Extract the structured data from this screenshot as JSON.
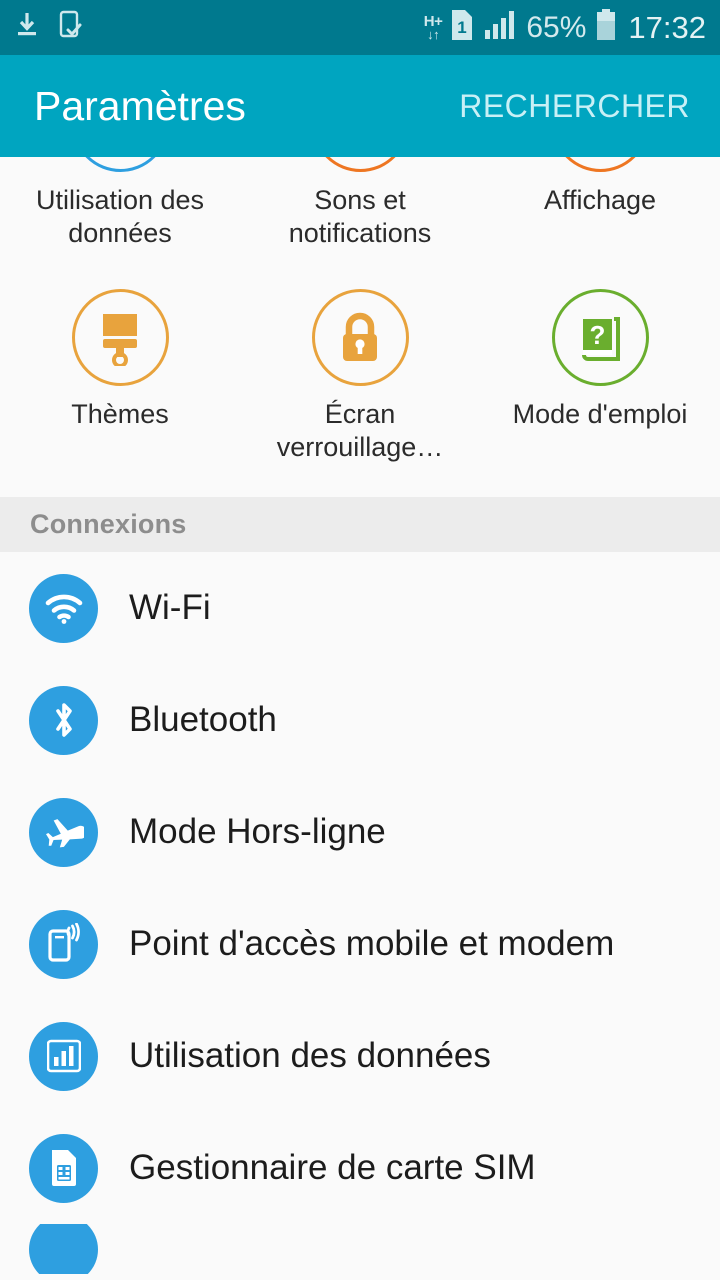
{
  "status_bar": {
    "background": "#00798e",
    "left_icons": [
      {
        "name": "download-icon",
        "label": "download"
      },
      {
        "name": "phone-check-icon",
        "label": "device-check"
      }
    ],
    "network_type": "H+",
    "sim_indicator": "1",
    "signal": "signal-bars-icon",
    "battery_percent": "65%",
    "battery_icon": "battery-icon",
    "time": "17:32"
  },
  "app_bar": {
    "title": "Paramètres",
    "action_label": "RECHERCHER",
    "background": "#00a5c0"
  },
  "grid": {
    "rows": [
      {
        "clipped": true,
        "cells": [
          {
            "label": "Utilisation des données",
            "icon": "data-usage-icon",
            "color": "blue",
            "accent": "#2e9fe0"
          },
          {
            "label": "Sons et notifications",
            "icon": "sound-notifications-icon",
            "color": "orange",
            "accent": "#ee7622"
          },
          {
            "label": "Affichage",
            "icon": "display-icon",
            "color": "orange",
            "accent": "#ee7622"
          }
        ]
      },
      {
        "clipped": false,
        "cells": [
          {
            "label": "Thèmes",
            "icon": "paintbrush-icon",
            "color": "amber",
            "accent": "#e8a33d"
          },
          {
            "label": "Écran verrouillage…",
            "icon": "padlock-icon",
            "color": "amber",
            "accent": "#e8a33d"
          },
          {
            "label": "Mode d'emploi",
            "icon": "book-question-icon",
            "color": "green",
            "accent": "#6aae2e"
          }
        ]
      }
    ]
  },
  "sections": [
    {
      "header": "Connexions",
      "items": [
        {
          "label": "Wi-Fi",
          "icon": "wifi-icon",
          "color": "#2e9fe0"
        },
        {
          "label": "Bluetooth",
          "icon": "bluetooth-icon",
          "color": "#2e9fe0"
        },
        {
          "label": "Mode Hors-ligne",
          "icon": "airplane-icon",
          "color": "#2e9fe0"
        },
        {
          "label": "Point d'accès mobile et modem",
          "icon": "tethering-hotspot-icon",
          "color": "#2e9fe0"
        },
        {
          "label": "Utilisation des données",
          "icon": "data-usage-bars-icon",
          "color": "#2e9fe0"
        },
        {
          "label": "Gestionnaire de carte SIM",
          "icon": "sim-card-icon",
          "color": "#2e9fe0"
        },
        {
          "label": "",
          "icon": "partial-icon",
          "color": "#2e9fe0"
        }
      ]
    }
  ]
}
